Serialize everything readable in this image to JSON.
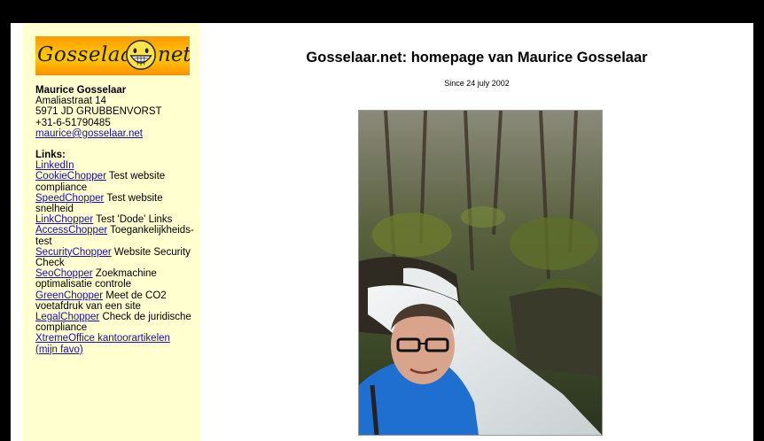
{
  "logo": {
    "text_left": "Gosselaar",
    "text_right": "net"
  },
  "contact": {
    "name": "Maurice Gosselaar",
    "street": "Amaliastraat 14",
    "city": "5971 JD GRUBBENVORST",
    "phone": "+31-6-51790485",
    "email": "maurice@gosselaar.net"
  },
  "links": {
    "heading": "Links:",
    "items": [
      {
        "link": "LinkedIn",
        "desc": ""
      },
      {
        "link": "CookieChopper",
        "desc": " Test website compliance"
      },
      {
        "link": "SpeedChopper",
        "desc": " Test website snelheid"
      },
      {
        "link": "LinkChopper",
        "desc": " Test 'Dode' Links"
      },
      {
        "link": "AccessChopper",
        "desc": " Toegankelijkheids-test"
      },
      {
        "link": "SecurityChopper",
        "desc": " Website Security Check"
      },
      {
        "link": "SeoChopper",
        "desc": " Zoekmachine optimalisatie controle"
      },
      {
        "link": "GreenChopper",
        "desc": " Meet de CO2 voetafdruk van een site"
      },
      {
        "link": "LegalChopper",
        "desc": " Check de juridische compliance"
      },
      {
        "link": "XtremeOffice kantoorartikelen (mijn favo)",
        "desc": ""
      }
    ]
  },
  "main": {
    "title": "Gosselaar.net: homepage van Maurice Gosselaar",
    "since": "Since 24 july 2002"
  }
}
